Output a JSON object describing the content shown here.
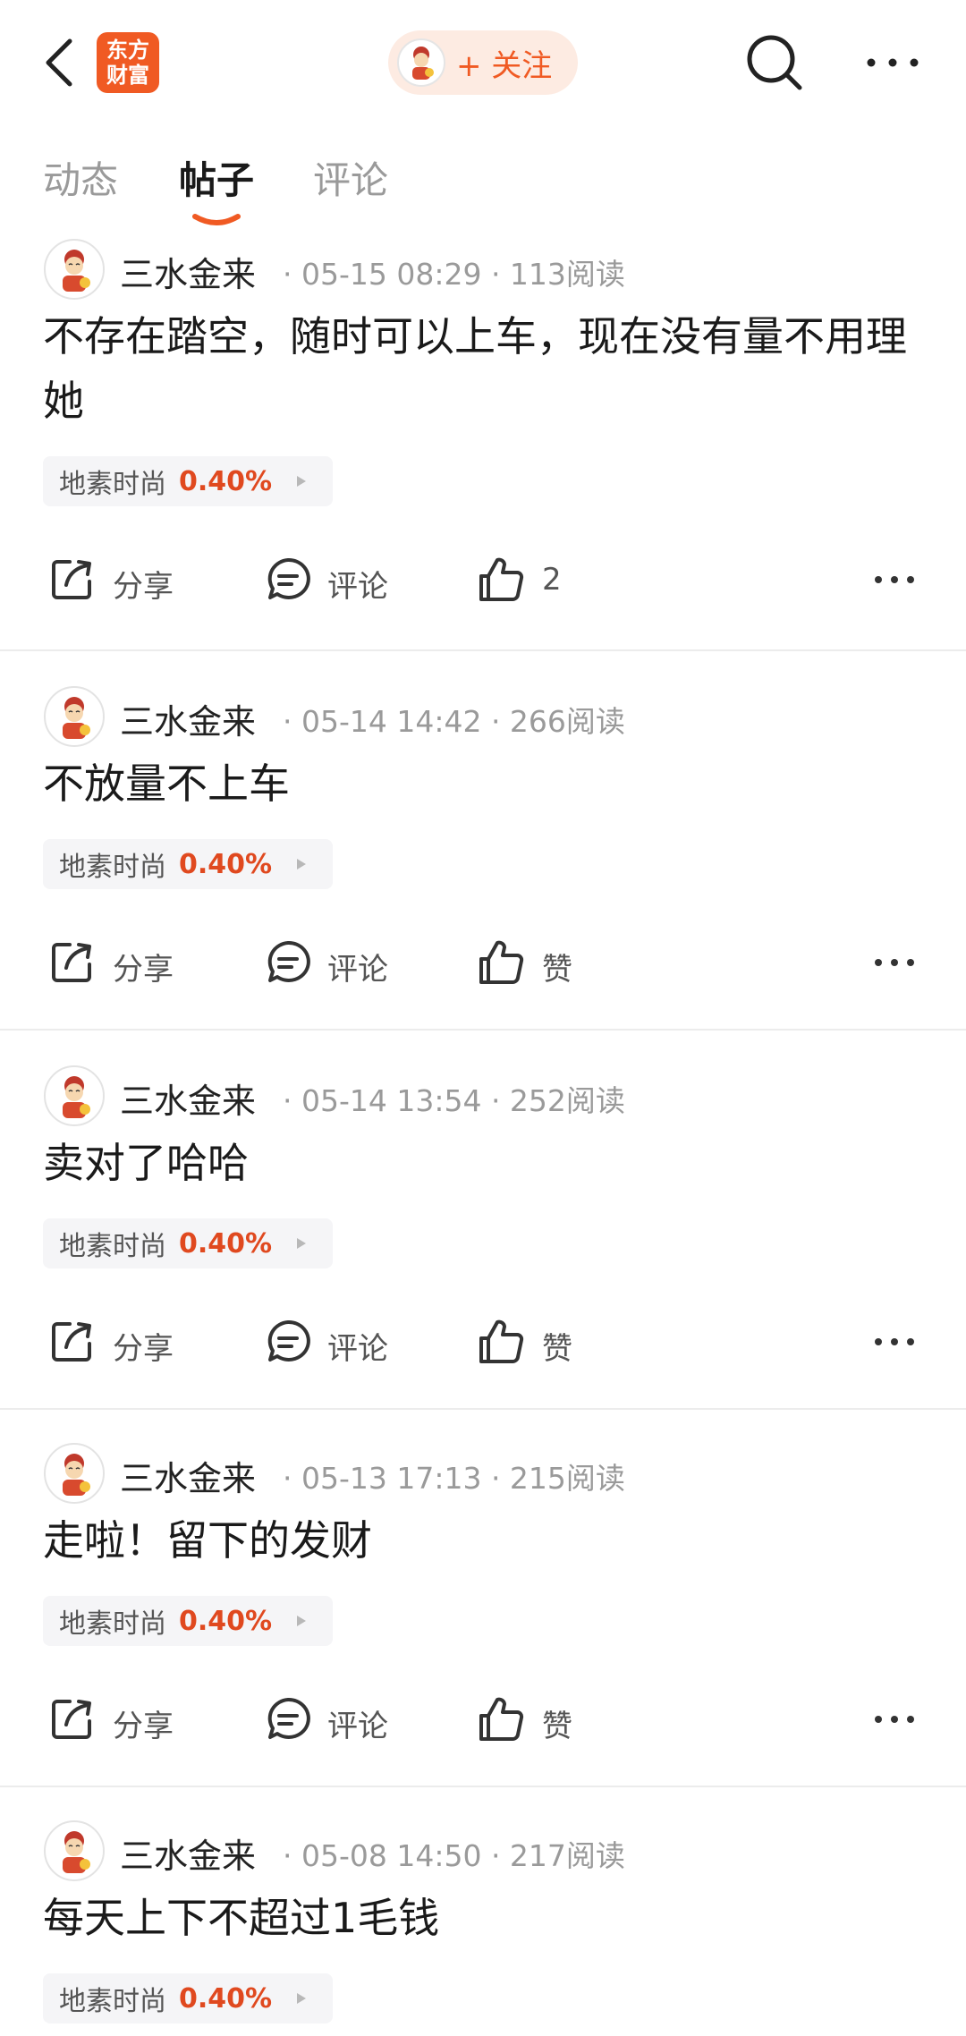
{
  "header": {
    "logo_line1": "东方",
    "logo_line2": "财富",
    "follow_label": "+ 关注"
  },
  "tabs": [
    {
      "label": "动态",
      "active": false
    },
    {
      "label": "帖子",
      "active": true
    },
    {
      "label": "评论",
      "active": false
    }
  ],
  "colors": {
    "brand": "#f05a23",
    "change_up": "#e0491f"
  },
  "posts": [
    {
      "author": "三水金来",
      "meta": "· 05-15 08:29 · 113阅读",
      "text": "不存在踏空，随时可以上车，现在没有量不用理她",
      "stock": {
        "name": "地素时尚",
        "change": "0.40%"
      },
      "share_label": "分享",
      "comment_label": "评论",
      "like_label": "2"
    },
    {
      "author": "三水金来",
      "meta": "· 05-14 14:42 · 266阅读",
      "text": "不放量不上车",
      "stock": {
        "name": "地素时尚",
        "change": "0.40%"
      },
      "share_label": "分享",
      "comment_label": "评论",
      "like_label": "赞"
    },
    {
      "author": "三水金来",
      "meta": "· 05-14 13:54 · 252阅读",
      "text": "卖对了哈哈",
      "stock": {
        "name": "地素时尚",
        "change": "0.40%"
      },
      "share_label": "分享",
      "comment_label": "评论",
      "like_label": "赞"
    },
    {
      "author": "三水金来",
      "meta": "· 05-13 17:13 · 215阅读",
      "text": "走啦！留下的发财",
      "stock": {
        "name": "地素时尚",
        "change": "0.40%"
      },
      "share_label": "分享",
      "comment_label": "评论",
      "like_label": "赞"
    },
    {
      "author": "三水金来",
      "meta": "· 05-08 14:50 · 217阅读",
      "text": "每天上下不超过1毛钱",
      "stock": {
        "name": "地素时尚",
        "change": "0.40%"
      }
    }
  ]
}
